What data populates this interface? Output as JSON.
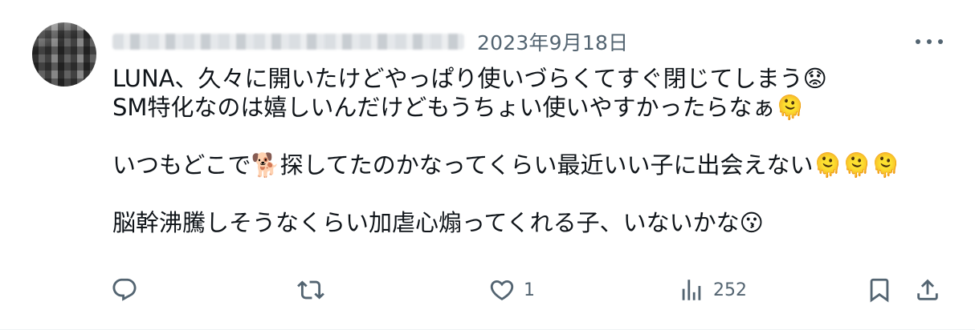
{
  "post": {
    "date": "2023年9月18日",
    "lines": [
      "LUNA、久々に開いたけどやっぱり使いづらくてすぐ閉じてしまう😟",
      "SM特化なのは嬉しいんだけどもうちょい使いやすかったらなぁ🫠",
      "",
      "いつもどこで🐕探してたのかなってくらい最近いい子に出会えない🫠🫠🫠",
      "",
      "脳幹沸騰しそうなくらい加虐心煽ってくれる子、いないかな😗"
    ]
  },
  "actions": {
    "reply_count": "",
    "repost_count": "",
    "like_count": "1",
    "views_count": "252"
  },
  "icons": {
    "more": "more-horizontal-icon",
    "reply": "reply-icon",
    "repost": "repost-icon",
    "like": "heart-icon",
    "views": "analytics-icon",
    "bookmark": "bookmark-icon",
    "share": "share-icon"
  },
  "colors": {
    "text": "#0f1419",
    "secondary": "#536471",
    "divider": "#eff3f4"
  }
}
